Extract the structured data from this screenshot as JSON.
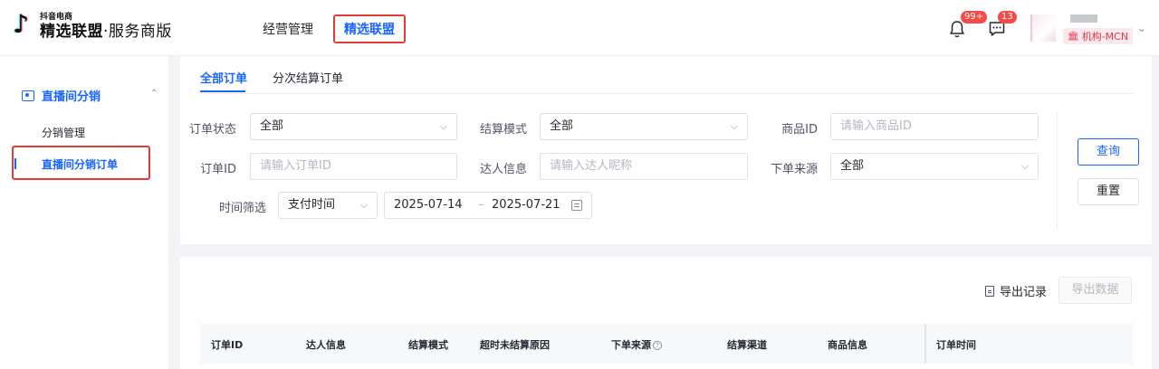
{
  "header": {
    "logo_sub": "抖音电商",
    "logo_main_bold": "精选联盟",
    "logo_main_rest": "·服务商版",
    "nav": [
      "经营管理",
      "精选联盟"
    ],
    "bell_badge": "99+",
    "chat_badge": "13",
    "user_tag": "机构-MCN"
  },
  "sidebar": {
    "group": "直播间分销",
    "items": [
      "分销管理",
      "直播间分销订单"
    ]
  },
  "tabs": [
    "全部订单",
    "分次结算订单"
  ],
  "filters": {
    "order_status": {
      "label": "订单状态",
      "value": "全部"
    },
    "settle_mode": {
      "label": "结算模式",
      "value": "全部"
    },
    "product_id": {
      "label": "商品ID",
      "placeholder": "请输入商品ID"
    },
    "order_id": {
      "label": "订单ID",
      "placeholder": "请输入订单ID"
    },
    "talent": {
      "label": "达人信息",
      "placeholder": "请输入达人昵称"
    },
    "source": {
      "label": "下单来源",
      "value": "全部"
    },
    "time": {
      "label": "时间筛选",
      "type": "支付时间",
      "start": "2025-07-14",
      "sep": "–",
      "end": "2025-07-21"
    }
  },
  "buttons": {
    "query": "查询",
    "reset": "重置",
    "export_records": "导出记录",
    "export_data": "导出数据"
  },
  "table": {
    "columns": [
      "订单ID",
      "达人信息",
      "结算模式",
      "超时未结算原因",
      "下单来源",
      "结算渠道",
      "商品信息",
      "订单时间"
    ]
  }
}
